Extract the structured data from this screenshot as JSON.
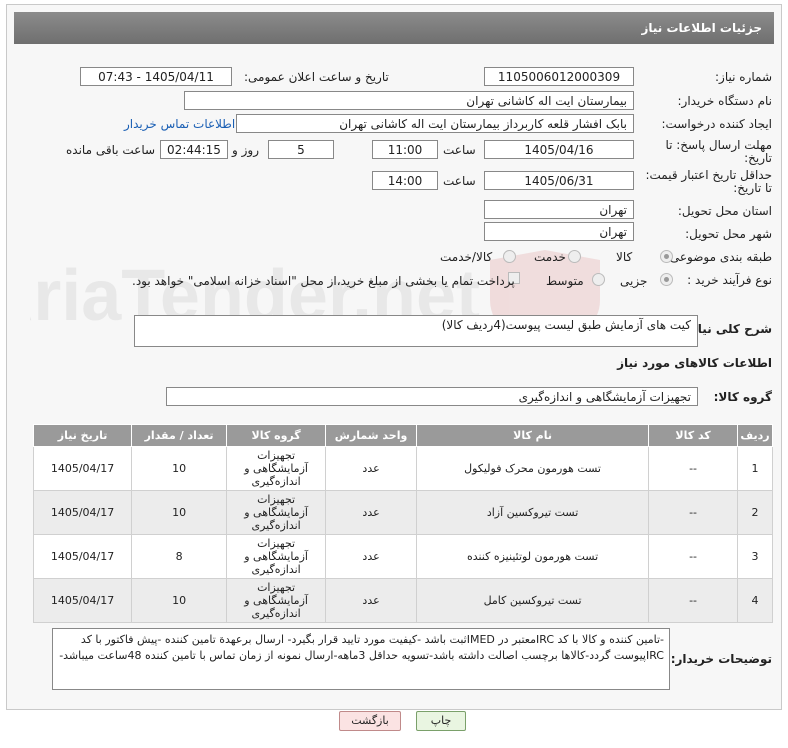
{
  "header": {
    "title": "جزئیات اطلاعات نیاز"
  },
  "fields": {
    "need_number_label": "شماره نیاز:",
    "need_number": "1105006012000309",
    "announce_label": "تاریخ و ساعت اعلان عمومی:",
    "announce_value": "1405/04/11 - 07:43",
    "buyer_org_label": "نام دستگاه خریدار:",
    "buyer_org": "بیمارستان ایت اله کاشانی تهران",
    "creator_label": "ایجاد کننده درخواست:",
    "creator": "بابک افشار قلعه کاربرداز بیمارستان ایت اله کاشانی تهران",
    "contact_link": "اطلاعات تماس خریدار",
    "reply_deadline_label_1": "مهلت ارسال پاسخ: تا",
    "reply_deadline_label_2": "تاریخ:",
    "reply_date": "1405/04/16",
    "time_label": "ساعت",
    "reply_time": "11:00",
    "days_value": "5",
    "days_label": "روز و",
    "remaining_time": "02:44:15",
    "remaining_label": "ساعت باقی مانده",
    "price_deadline_label_1": "حداقل تاریخ اعتبار قیمت:",
    "price_deadline_label_2": "تا تاریخ:",
    "price_date": "1405/06/31",
    "price_time": "14:00",
    "province_label": "استان محل تحویل:",
    "province": "تهران",
    "city_label": "شهر محل تحویل:",
    "city": "تهران",
    "category_label": "طبقه بندی موضوعی:",
    "category_options": [
      "کالا",
      "خدمت",
      "کالا/خدمت"
    ],
    "process_label": "نوع فرآیند خرید :",
    "process_options": [
      "جزیی",
      "متوسط"
    ],
    "payment_note": "پرداخت تمام یا بخشی از مبلغ خرید،از محل \"اسناد خزانه اسلامی\" خواهد بود."
  },
  "summary": {
    "label": "شرح کلی نیاز:",
    "value": "کیت های آزمایش طبق لیست پیوست(4ردیف کالا)"
  },
  "goods_section": {
    "title": "اطلاعات کالاهای مورد نیاز",
    "group_label": "گروه کالا:",
    "group_value": "تجهیزات آزمایشگاهی و اندازه‌گیری"
  },
  "table": {
    "headers": [
      "ردیف",
      "کد کالا",
      "نام کالا",
      "واحد شمارش",
      "گروه کالا",
      "تعداد / مقدار",
      "تاریخ نیاز"
    ],
    "rows": [
      {
        "row": "1",
        "code": "--",
        "name": "تست هورمون محرک فولیکول",
        "unit": "عدد",
        "group": "تجهیزات آزمایشگاهی و اندازه‌گیری",
        "qty": "10",
        "date": "1405/04/17"
      },
      {
        "row": "2",
        "code": "--",
        "name": "تست تیروکسین آزاد",
        "unit": "عدد",
        "group": "تجهیزات آزمایشگاهی و اندازه‌گیری",
        "qty": "10",
        "date": "1405/04/17"
      },
      {
        "row": "3",
        "code": "--",
        "name": "تست هورمون لوتئینیزه کننده",
        "unit": "عدد",
        "group": "تجهیزات آزمایشگاهی و اندازه‌گیری",
        "qty": "8",
        "date": "1405/04/17"
      },
      {
        "row": "4",
        "code": "--",
        "name": "تست تیروکسین کامل",
        "unit": "عدد",
        "group": "تجهیزات آزمایشگاهی و اندازه‌گیری",
        "qty": "10",
        "date": "1405/04/17"
      }
    ]
  },
  "buyer_notes": {
    "label": "توضیحات خریدار:",
    "value": "-تامین کننده و کالا با کد IRCمعتبر در IMEDثبت باشد -کیفیت مورد تایید قرار بگیرد- ارسال برعهدة تامین کننده -پیش فاکتور با کد IRCپیوست گردد-کالاها برچسب اصالت داشته باشد-تسویه حداقل 3ماهه-ارسال نمونه از زمان تماس با تامین کننده 48ساعت میباشد-"
  },
  "buttons": {
    "print": "چاپ",
    "back": "بازگشت"
  },
  "watermark": "AriaTender.net"
}
